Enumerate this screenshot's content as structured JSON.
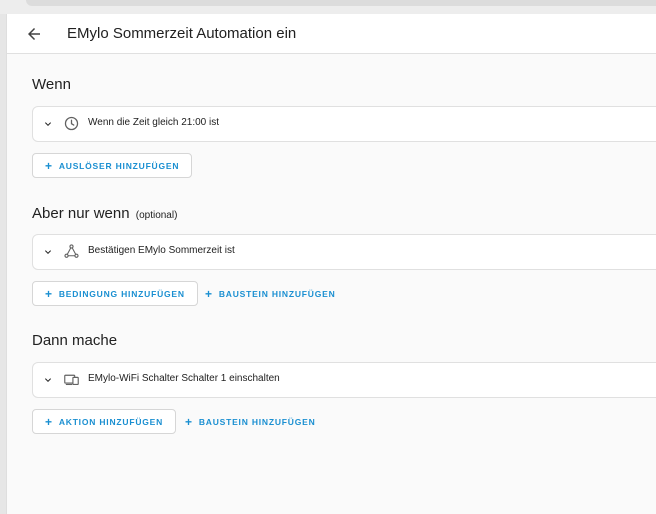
{
  "header": {
    "title": "EMylo Sommerzeit Automation ein"
  },
  "triggers": {
    "title": "Wenn",
    "items": [
      {
        "icon": "clock-icon",
        "label": "Wenn die Zeit gleich 21:00 ist"
      }
    ],
    "add_trigger_label": "AUSLÖSER HINZUFÜGEN"
  },
  "conditions": {
    "title": "Aber nur wenn",
    "optional": "(optional)",
    "items": [
      {
        "icon": "logic-graph-icon",
        "label": "Bestätigen EMylo Sommerzeit ist"
      }
    ],
    "add_condition_label": "BEDINGUNG HINZUFÜGEN",
    "add_block_label": "BAUSTEIN HINZUFÜGEN"
  },
  "actions": {
    "title": "Dann mache",
    "items": [
      {
        "icon": "devices-icon",
        "label": "EMylo-WiFi Schalter Schalter 1 einschalten"
      }
    ],
    "add_action_label": "AKTION HINZUFÜGEN",
    "add_block_label": "BAUSTEIN HINZUFÜGEN"
  },
  "colors": {
    "accent": "#1a8fd1",
    "background": "#fafafa",
    "card": "#ffffff"
  }
}
